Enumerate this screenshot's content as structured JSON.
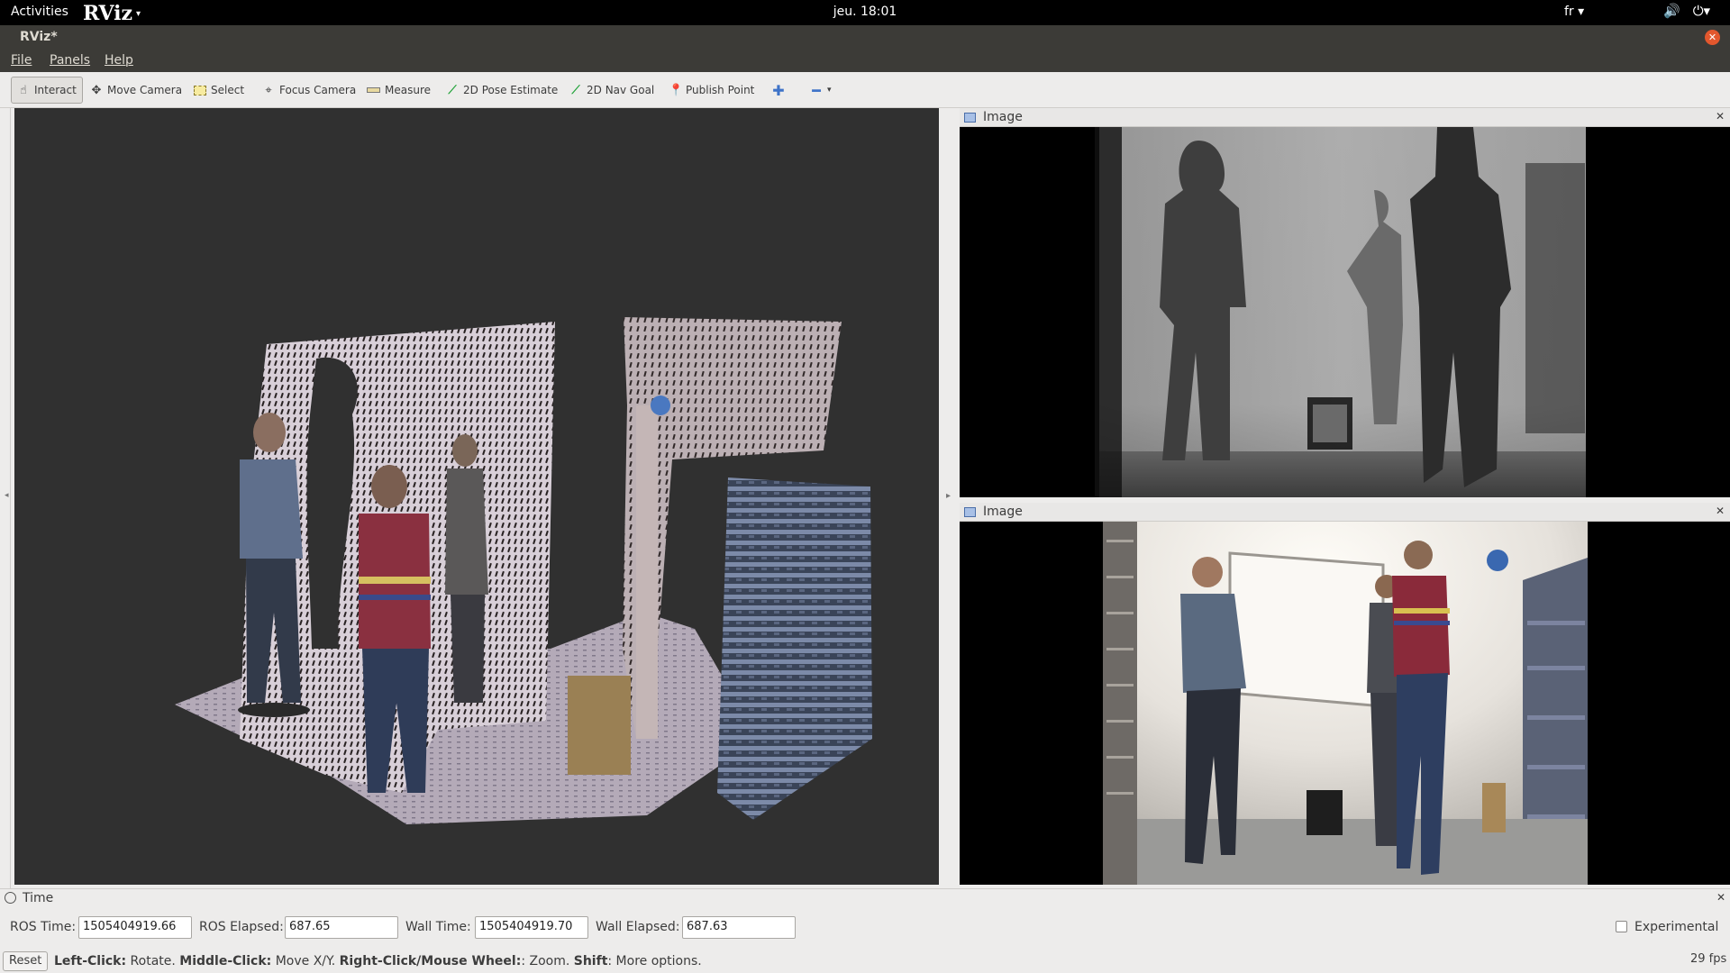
{
  "topbar": {
    "activities": "Activities",
    "app_logo": "RViz",
    "app_menu_arrow": "▾",
    "clock": "jeu. 18:01",
    "language": "fr ▾",
    "icons": [
      "volume-icon",
      "power-icon"
    ]
  },
  "window": {
    "title": "RViz*"
  },
  "menu": {
    "file": "File",
    "panels": "Panels",
    "help": "Help"
  },
  "toolbar": {
    "interact": "Interact",
    "move_camera": "Move Camera",
    "select": "Select",
    "focus_camera": "Focus Camera",
    "measure": "Measure",
    "pose_estimate": "2D Pose Estimate",
    "nav_goal": "2D Nav Goal",
    "publish_point": "Publish Point"
  },
  "panels": {
    "depth_image_title": "Image",
    "rgb_image_title": "Image"
  },
  "time_panel": {
    "title": "Time",
    "ros_time_label": "ROS Time:",
    "ros_time_value": "1505404919.66",
    "ros_elapsed_label": "ROS Elapsed:",
    "ros_elapsed_value": "687.65",
    "wall_time_label": "Wall Time:",
    "wall_time_value": "1505404919.70",
    "wall_elapsed_label": "Wall Elapsed:",
    "wall_elapsed_value": "687.63",
    "experimental_label": "Experimental"
  },
  "status": {
    "reset": "Reset",
    "hint_left_key": "Left-Click:",
    "hint_left_val": " Rotate. ",
    "hint_middle_key": "Middle-Click:",
    "hint_middle_val": " Move X/Y. ",
    "hint_right_key": "Right-Click/Mouse Wheel:",
    "hint_right_val": ": Zoom. ",
    "hint_shift_key": "Shift",
    "hint_shift_val": ": More options.",
    "fps": "29 fps"
  },
  "colors": {
    "view_background": "#303030",
    "titlebar": "#3c3b37",
    "panel_chrome": "#edeceb"
  }
}
